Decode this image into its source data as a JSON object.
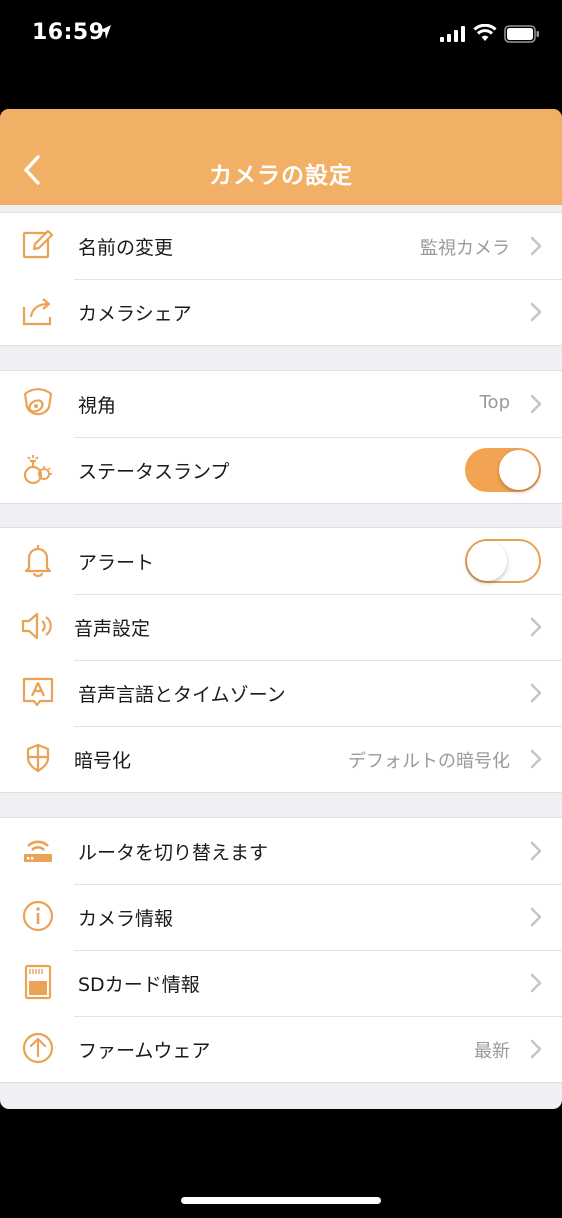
{
  "status_bar": {
    "time": "16:59"
  },
  "nav": {
    "title": "カメラの設定"
  },
  "sections": [
    {
      "rows": [
        {
          "label": "名前の変更",
          "value": "監視カメラ",
          "icon": "edit-icon"
        },
        {
          "label": "カメラシェア",
          "value": "",
          "icon": "share-icon"
        }
      ]
    },
    {
      "rows": [
        {
          "label": "視角",
          "value": "Top",
          "icon": "camera-view-icon"
        },
        {
          "label": "ステータスランプ",
          "toggle": true,
          "icon": "status-lamp-icon"
        }
      ]
    },
    {
      "rows": [
        {
          "label": "アラート",
          "toggle": false,
          "icon": "bell-icon"
        },
        {
          "label": "音声設定",
          "icon": "speaker-icon"
        },
        {
          "label": "音声言語とタイムゾーン",
          "icon": "language-icon"
        },
        {
          "label": "暗号化",
          "value": "デフォルトの暗号化",
          "icon": "shield-icon"
        }
      ]
    },
    {
      "rows": [
        {
          "label": "ルータを切り替えます",
          "icon": "router-icon"
        },
        {
          "label": "カメラ情報",
          "icon": "info-icon"
        },
        {
          "label": "SDカード情報",
          "icon": "sd-card-icon"
        },
        {
          "label": "ファームウェア",
          "value": "最新",
          "icon": "firmware-upgrade-icon"
        }
      ]
    }
  ],
  "colors": {
    "accent": "#f2af66",
    "icon": "#eaa354",
    "toggle_on": "#f2a453",
    "background": "#efeff4"
  }
}
